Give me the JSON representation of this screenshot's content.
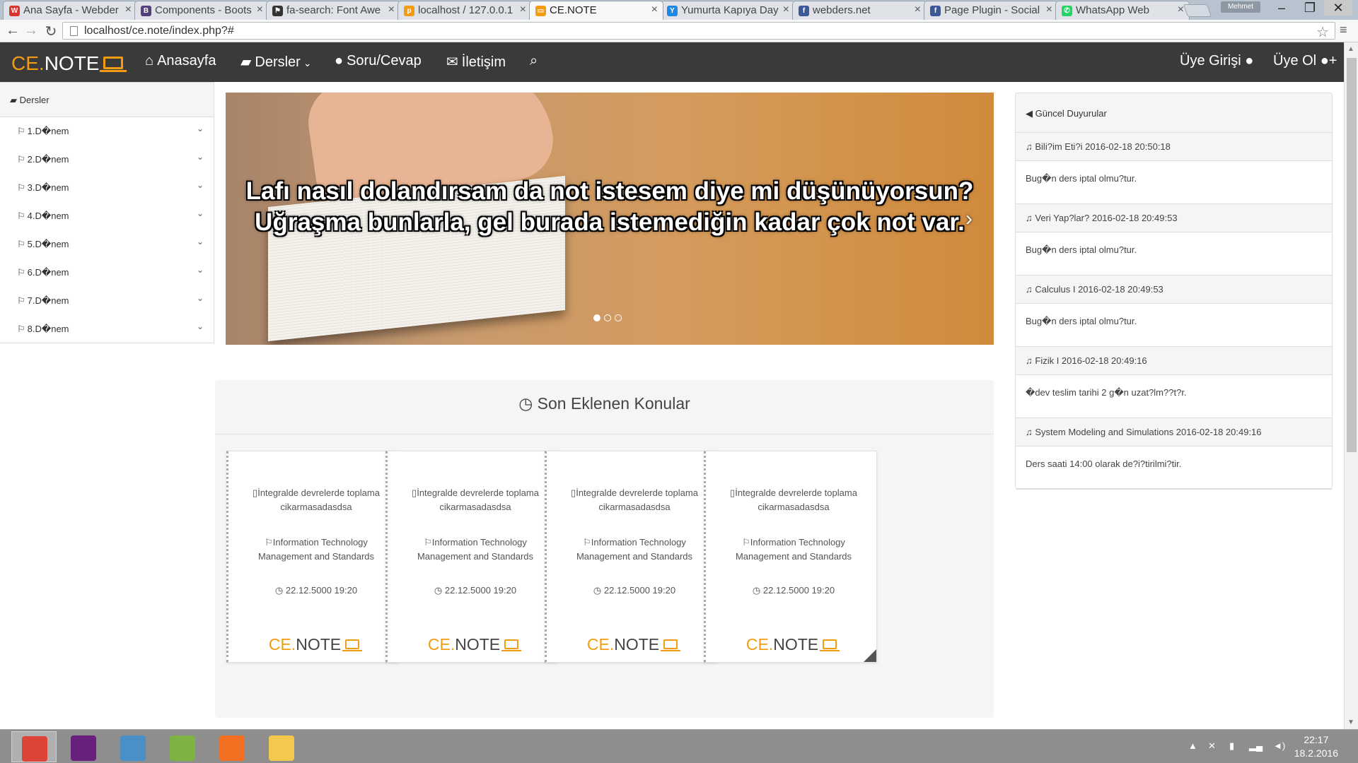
{
  "browser": {
    "tabs": [
      {
        "title": "Ana Sayfa - Webder",
        "favicon_color": "#d9342b",
        "favicon_letter": "W"
      },
      {
        "title": "Components - Boots",
        "favicon_color": "#563d7c",
        "favicon_letter": "B"
      },
      {
        "title": "fa-search: Font Awe",
        "favicon_color": "#333333",
        "favicon_letter": "⚑"
      },
      {
        "title": "localhost / 127.0.0.1",
        "favicon_color": "#f39c12",
        "favicon_letter": "p"
      },
      {
        "title": "CE.NOTE",
        "favicon_color": "#f39c12",
        "favicon_letter": "▭"
      },
      {
        "title": "Yumurta Kapıya Day",
        "favicon_color": "#1e88e5",
        "favicon_letter": "Y"
      },
      {
        "title": "webders.net",
        "favicon_color": "#3b5998",
        "favicon_letter": "f"
      },
      {
        "title": "Page Plugin - Social",
        "favicon_color": "#3b5998",
        "favicon_letter": "f"
      },
      {
        "title": "WhatsApp Web",
        "favicon_color": "#25d366",
        "favicon_letter": "✆"
      }
    ],
    "active_tab_index": 4,
    "profile_name": "Mehmet",
    "url": "localhost/ce.note/index.php?#"
  },
  "navbar": {
    "brand_ce": "CE.",
    "brand_note": "NOTE",
    "links": [
      {
        "label": "Anasayfa",
        "icon": "home-icon"
      },
      {
        "label": "Dersler",
        "icon": "book-icon"
      },
      {
        "label": "Soru/Cevap",
        "icon": "comment-icon"
      },
      {
        "label": "İletişim",
        "icon": "envelope-icon"
      }
    ],
    "login_label": "Üye Girişi",
    "register_label": "Üye Ol"
  },
  "sidebar": {
    "title": "Dersler",
    "items": [
      "1.D�nem",
      "2.D�nem",
      "3.D�nem",
      "4.D�nem",
      "5.D�nem",
      "6.D�nem",
      "7.D�nem",
      "8.D�nem"
    ]
  },
  "carousel": {
    "caption_line1": "Lafı nasıl dolandırsam da not istesem diye mi düşünüyorsun?",
    "caption_line2": "Uğraşma bunlarla, gel burada istemediğin kadar çok not var.",
    "slide_count": 3,
    "active_slide": 0
  },
  "announcements": {
    "title": "Güncel Duyurular",
    "items": [
      {
        "title": "Bili?im Eti?i 2016-02-18 20:50:18",
        "body": "Bug�n ders iptal olmu?tur."
      },
      {
        "title": "Veri Yap?lar? 2016-02-18 20:49:53",
        "body": "Bug�n ders iptal olmu?tur."
      },
      {
        "title": "Calculus I 2016-02-18 20:49:53",
        "body": "Bug�n ders iptal olmu?tur."
      },
      {
        "title": "Fizik I 2016-02-18 20:49:16",
        "body": "�dev teslim tarihi 2 g�n uzat?lm??t?r."
      },
      {
        "title": "System Modeling and Simulations 2016-02-18 20:49:16",
        "body": "Ders saati 14:00 olarak de?i?tirilmi?tir."
      }
    ]
  },
  "latest": {
    "title": "Son Eklenen Konular",
    "cards": [
      {
        "topic": "İntegralde devrelerde toplama cikarmasadasdsa",
        "course": "Information Technology Management and Standards",
        "date": "22.12.5000 19:20",
        "logo_ce": "CE.",
        "logo_note": "NOTE"
      },
      {
        "topic": "İntegralde devrelerde toplama cikarmasadasdsa",
        "course": "Information Technology Management and Standards",
        "date": "22.12.5000 19:20",
        "logo_ce": "CE.",
        "logo_note": "NOTE"
      },
      {
        "topic": "İntegralde devrelerde toplama cikarmasadasdsa",
        "course": "Information Technology Management and Standards",
        "date": "22.12.5000 19:20",
        "logo_ce": "CE.",
        "logo_note": "NOTE"
      },
      {
        "topic": "İntegralde devrelerde toplama cikarmasadasdsa",
        "course": "Information Technology Management and Standards",
        "date": "22.12.5000 19:20",
        "logo_ce": "CE.",
        "logo_note": "NOTE"
      }
    ]
  },
  "taskbar": {
    "apps": [
      {
        "name": "chrome-taskbar-icon",
        "color": "#db4437"
      },
      {
        "name": "visual-studio-taskbar-icon",
        "color": "#68217a"
      },
      {
        "name": "virtualbox-taskbar-icon",
        "color": "#4a90c8"
      },
      {
        "name": "notepad-taskbar-icon",
        "color": "#7cb342"
      },
      {
        "name": "xampp-taskbar-icon",
        "color": "#f36f21"
      },
      {
        "name": "file-explorer-taskbar-icon",
        "color": "#f2c94c"
      }
    ],
    "time": "22:17",
    "date": "18.2.2016"
  }
}
